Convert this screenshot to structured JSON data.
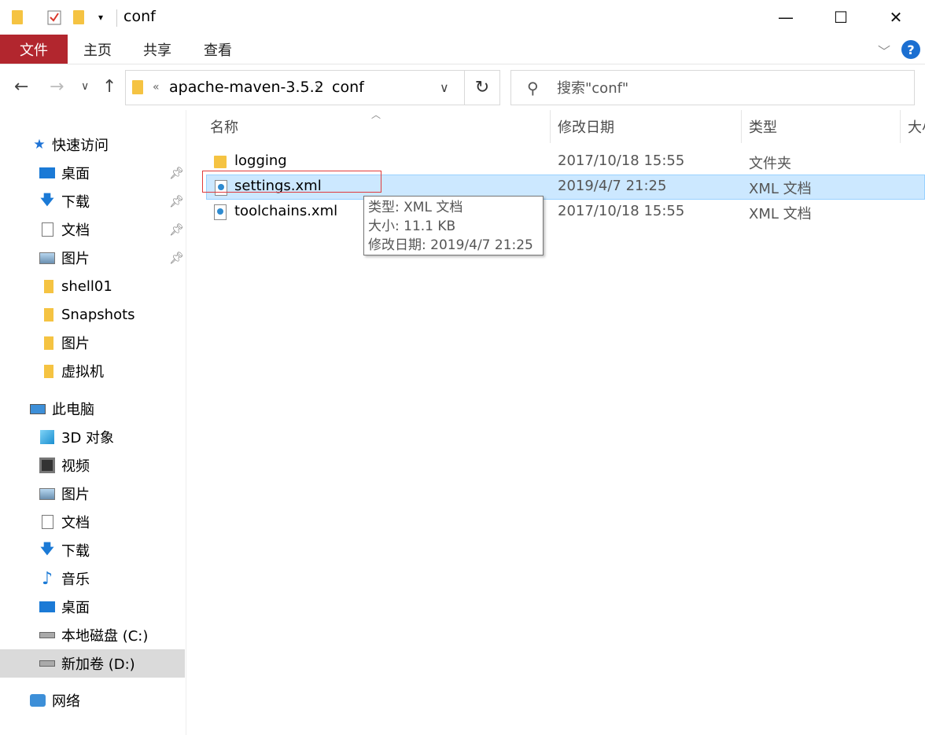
{
  "window": {
    "title": "conf",
    "controls": {
      "minimize": "—",
      "maximize": "☐",
      "close": "✕"
    }
  },
  "ribbon": {
    "tabs": [
      "文件",
      "主页",
      "共享",
      "查看"
    ],
    "help": "?"
  },
  "address": {
    "overflow": "«",
    "crumbs": [
      "apache-maven-3.5.2",
      "conf"
    ],
    "separator": "›"
  },
  "search": {
    "placeholder": "搜索\"conf\""
  },
  "sidebar": {
    "quick_access": "快速访问",
    "quick_items": [
      "桌面",
      "下载",
      "文档",
      "图片",
      "shell01",
      "Snapshots",
      "图片",
      "虚拟机"
    ],
    "this_pc": "此电脑",
    "pc_items": [
      "3D 对象",
      "视频",
      "图片",
      "文档",
      "下载",
      "音乐",
      "桌面",
      "本地磁盘 (C:)",
      "新加卷 (D:)"
    ],
    "network": "网络"
  },
  "columns": {
    "name": "名称",
    "modified": "修改日期",
    "type": "类型",
    "size": "大小"
  },
  "files": [
    {
      "name": "logging",
      "modified": "2017/10/18 15:55",
      "type": "文件夹",
      "icon": "folder-icon"
    },
    {
      "name": "settings.xml",
      "modified": "2019/4/7 21:25",
      "type": "XML 文档",
      "icon": "xml-file-icon"
    },
    {
      "name": "toolchains.xml",
      "modified": "2017/10/18 15:55",
      "type": "XML 文档",
      "icon": "xml-file-icon"
    }
  ],
  "tooltip": {
    "type": "类型: XML 文档",
    "size": "大小: 11.1 KB",
    "modified": "修改日期: 2019/4/7 21:25"
  },
  "colors": {
    "file_tab": "#b2262e",
    "selection": "#cce8ff",
    "highlight_box": "#e03a3a"
  }
}
